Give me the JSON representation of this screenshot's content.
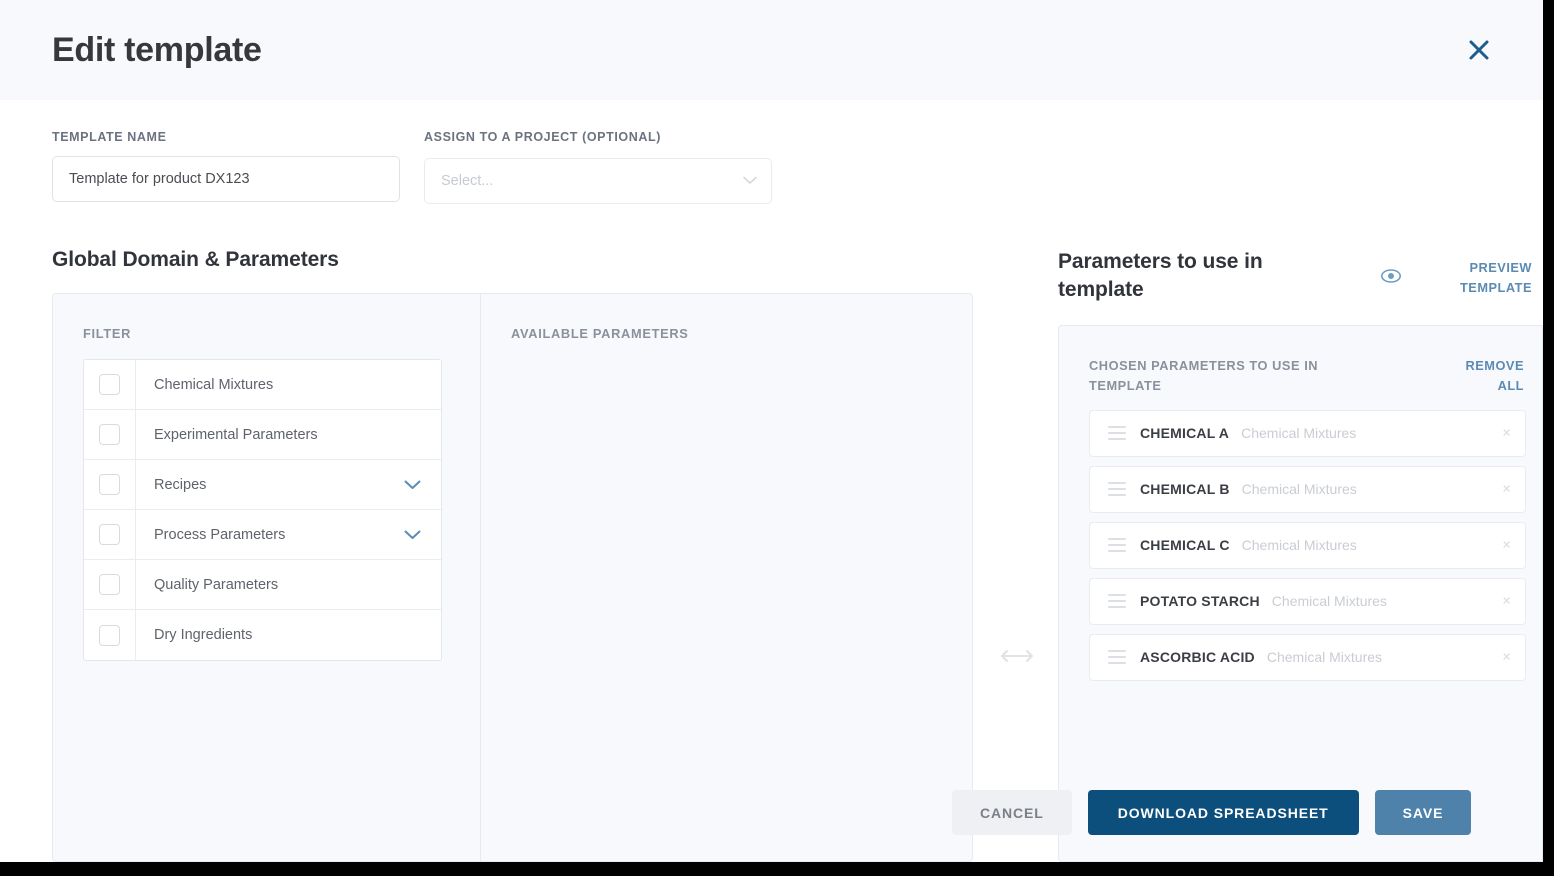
{
  "header": {
    "title": "Edit template",
    "close_icon": "close-icon"
  },
  "form": {
    "template_name": {
      "label": "TEMPLATE NAME",
      "value": "Template for product DX123"
    },
    "assign_project": {
      "label": "ASSIGN TO A PROJECT (OPTIONAL)",
      "placeholder": "Select...",
      "chevron_icon": "chevron-down-icon"
    }
  },
  "left_section": {
    "title": "Global Domain & Parameters",
    "filter_label": "FILTER",
    "available_label": "AVAILABLE PARAMETERS",
    "filter_items": [
      {
        "label": "Chemical Mixtures",
        "checked": false,
        "expandable": false
      },
      {
        "label": "Experimental Parameters",
        "checked": false,
        "expandable": false
      },
      {
        "label": "Recipes",
        "checked": false,
        "expandable": true
      },
      {
        "label": "Process Parameters",
        "checked": false,
        "expandable": true
      },
      {
        "label": "Quality Parameters",
        "checked": false,
        "expandable": false
      },
      {
        "label": "Dry Ingredients",
        "checked": false,
        "expandable": false
      }
    ]
  },
  "swap_icon": "left-right-arrow-icon",
  "right_section": {
    "title": "Parameters to use in template",
    "preview_template_label": "PREVIEW TEMPLATE",
    "eye_icon": "eye-icon",
    "chosen_label": "CHOSEN PARAMETERS TO USE IN TEMPLATE",
    "remove_all_label": "REMOVE ALL",
    "chosen_items": [
      {
        "name": "CHEMICAL A",
        "group": "Chemical Mixtures"
      },
      {
        "name": "CHEMICAL B",
        "group": "Chemical Mixtures"
      },
      {
        "name": "CHEMICAL C",
        "group": "Chemical Mixtures"
      },
      {
        "name": "POTATO STARCH",
        "group": "Chemical Mixtures"
      },
      {
        "name": "ASCORBIC ACID",
        "group": "Chemical Mixtures"
      }
    ],
    "remove_icon_glyph": "×"
  },
  "footer": {
    "cancel_label": "CANCEL",
    "download_label": "DOWNLOAD SPREADSHEET",
    "save_label": "SAVE"
  },
  "colors": {
    "accent_dark_blue": "#0d4f7c",
    "accent_muted_blue": "#4e82ab",
    "link_blue": "#5b8bb5",
    "panel_bg": "#f7f9fc",
    "border": "#e6eaf0"
  }
}
